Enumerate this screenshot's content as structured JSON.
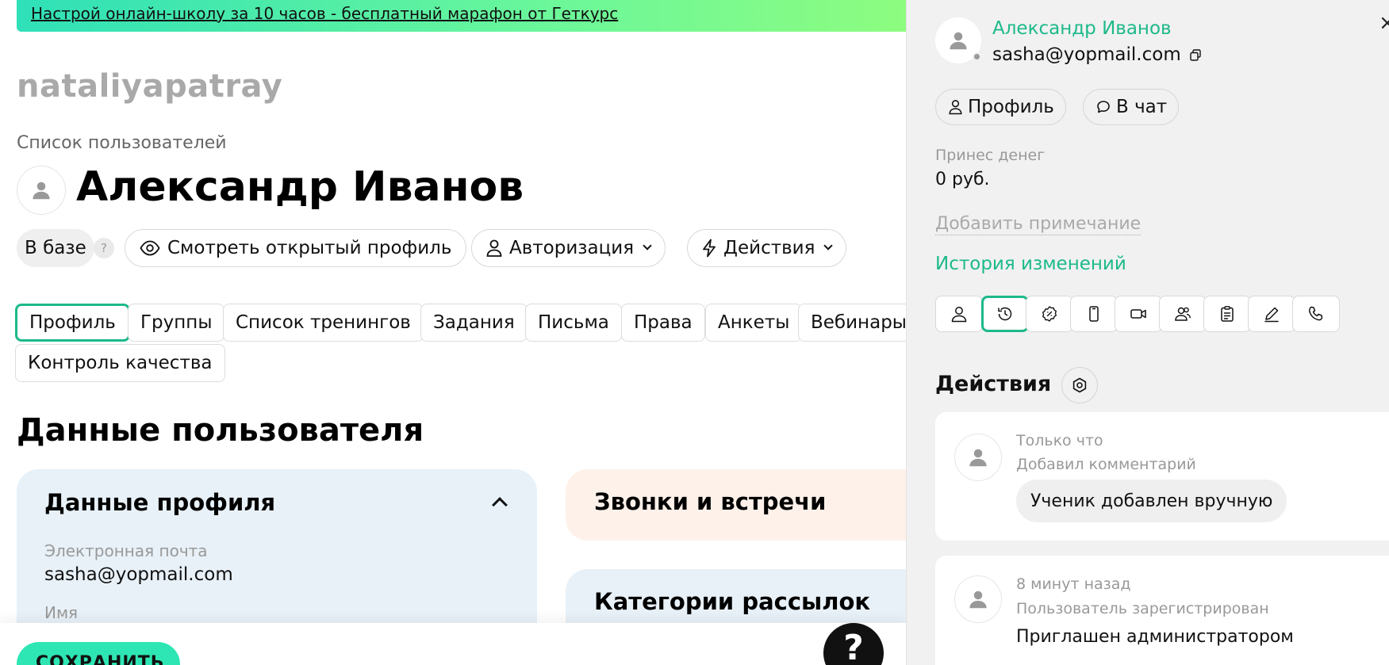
{
  "promo": {
    "text": "Настрой онлайн-школу за 10 часов - бесплатный марафон от Геткурс"
  },
  "school_name": "nataliyapatray",
  "breadcrumb": "Список пользователей",
  "user": {
    "name": "Александр Иванов",
    "email": "sasha@yopmail.com"
  },
  "status": {
    "label": "В базе",
    "help": "?"
  },
  "toolbar": {
    "view_profile": "Смотреть открытый профиль",
    "auth": "Авторизация",
    "actions": "Действия"
  },
  "tabs": [
    {
      "label": "Профиль",
      "active": true
    },
    {
      "label": "Группы"
    },
    {
      "label": "Список тренингов"
    },
    {
      "label": "Задания"
    },
    {
      "label": "Письма"
    },
    {
      "label": "Права"
    },
    {
      "label": "Анкеты"
    },
    {
      "label": "Вебинары"
    },
    {
      "label": "Контроль качества"
    }
  ],
  "section_title": "Данные пользователя",
  "profile_card": {
    "title": "Данные профиля",
    "email_label": "Электронная почта",
    "email_value": "sasha@yopmail.com",
    "name_label": "Имя"
  },
  "calls_card": {
    "title": "Звонки и встречи"
  },
  "mailing_card": {
    "title": "Категории рассылок"
  },
  "save_button": "СОХРАНИТЬ",
  "help_button": "?",
  "panel": {
    "close": "×",
    "name": "Александр Иванов",
    "email": "sasha@yopmail.com",
    "profile_btn": "Профиль",
    "chat_btn": "В чат",
    "money_label": "Принес денег",
    "money_value": "0 руб.",
    "add_note": "Добавить примечание",
    "history": "История изменений",
    "icon_tabs": [
      "user-icon",
      "history-icon",
      "settings-badge-icon",
      "phone-device-icon",
      "video-icon",
      "users-icon",
      "clipboard-icon",
      "pencil-icon",
      "phone-call-icon"
    ],
    "actions_title": "Действия",
    "events": [
      {
        "time": "Только что",
        "type": "Добавил комментарий",
        "text": "Ученик добавлен вручную"
      },
      {
        "time": "8 минут назад",
        "type": "Пользователь зарегистрирован",
        "text": "Приглашен администратором"
      }
    ]
  },
  "colors": {
    "accent": "#1db98a",
    "save": "#2ee6b3",
    "card_blue": "#e8f1f8",
    "card_peach": "#fdf1ea"
  }
}
